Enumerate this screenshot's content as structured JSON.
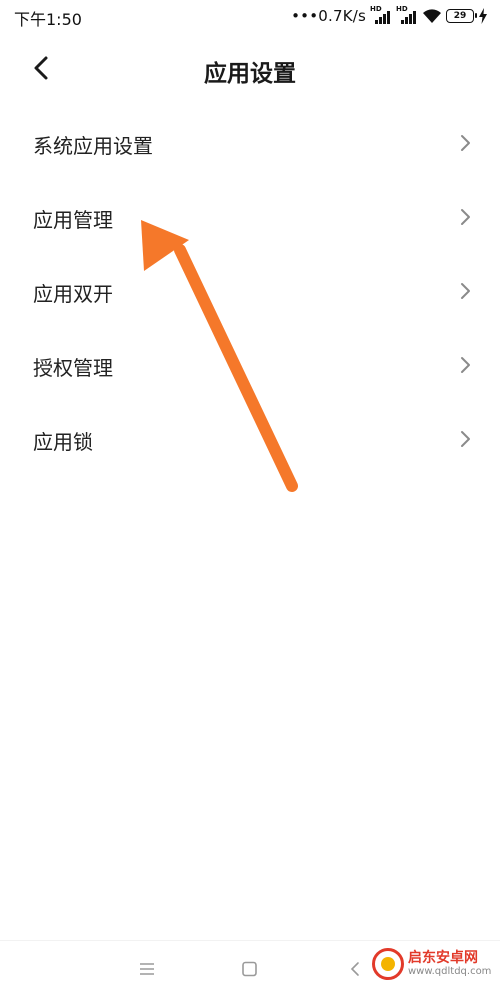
{
  "status_bar": {
    "time": "下午1:50",
    "net_speed": "•••0.7K/s",
    "battery_level": "29"
  },
  "header": {
    "title": "应用设置"
  },
  "settings_items": [
    {
      "label": "系统应用设置"
    },
    {
      "label": "应用管理"
    },
    {
      "label": "应用双开"
    },
    {
      "label": "授权管理"
    },
    {
      "label": "应用锁"
    }
  ],
  "overlay": {
    "arrow_color": "#f5782a"
  },
  "watermark": {
    "name": "启东安卓网",
    "url": "www.qdltdq.com"
  },
  "icons": {
    "back": "back-arrow-icon",
    "chevron": "chevron-right-icon",
    "nav_menu": "menu-icon",
    "nav_home": "home-icon",
    "nav_back": "back-icon"
  }
}
